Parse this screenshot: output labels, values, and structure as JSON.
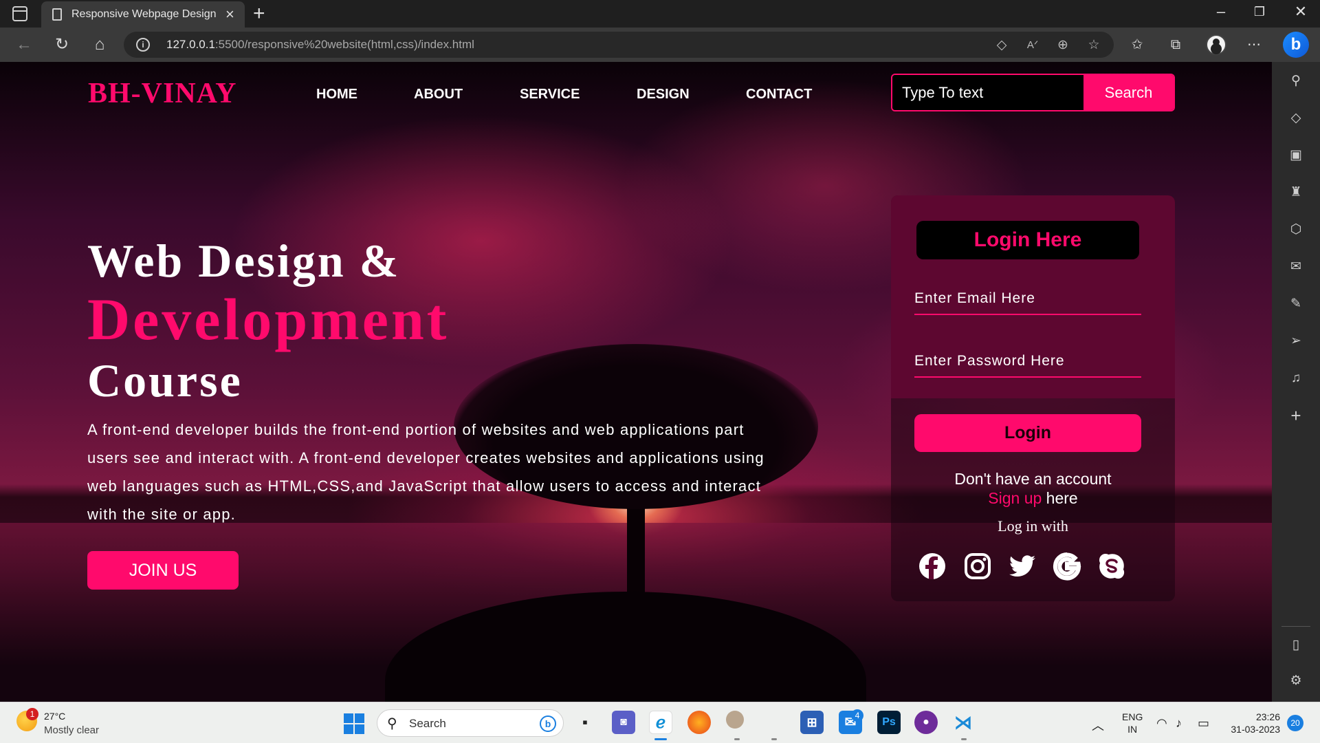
{
  "browser": {
    "tab_title": "Responsive Webpage Design",
    "url_host": "127.0.0.1",
    "url_rest": ":5500/responsive%20website(html,css)/index.html"
  },
  "site": {
    "logo": "BH-VINAY",
    "menu": [
      "HOME",
      "ABOUT",
      "SERVICE",
      "DESIGN",
      "CONTACT"
    ],
    "search": {
      "placeholder": "Type To text",
      "button": "Search"
    },
    "hero": {
      "line1": "Web Design &",
      "line2": "Development",
      "line3": "Course",
      "paragraph": "A front-end developer builds the front-end portion of websites and web applications part users see and interact with. A front-end developer creates websites and applications using web languages such as HTML,CSS,and JavaScript that allow users to access and interact with the site or app.",
      "cta": "JOIN US"
    },
    "login": {
      "title": "Login Here",
      "email_placeholder": "Enter Email Here",
      "password_placeholder": "Enter Password Here",
      "button": "Login",
      "no_account": "Don't have an account",
      "signup_link": "Sign up",
      "signup_suffix": "here",
      "log_in_with": "Log in with",
      "socials": [
        "facebook-icon",
        "instagram-icon",
        "twitter-icon",
        "google-icon",
        "skype-icon"
      ]
    },
    "colors": {
      "accent": "#ff0a6c",
      "card": "#5d0730"
    }
  },
  "taskbar": {
    "weather_temp": "27°C",
    "weather_cond": "Mostly clear",
    "weather_badge": "1",
    "search_label": "Search",
    "mail_badge": "4",
    "ps_label": "Ps",
    "lang_1": "ENG",
    "lang_2": "IN",
    "time": "23:26",
    "date": "31-03-2023",
    "notifications": "20"
  }
}
